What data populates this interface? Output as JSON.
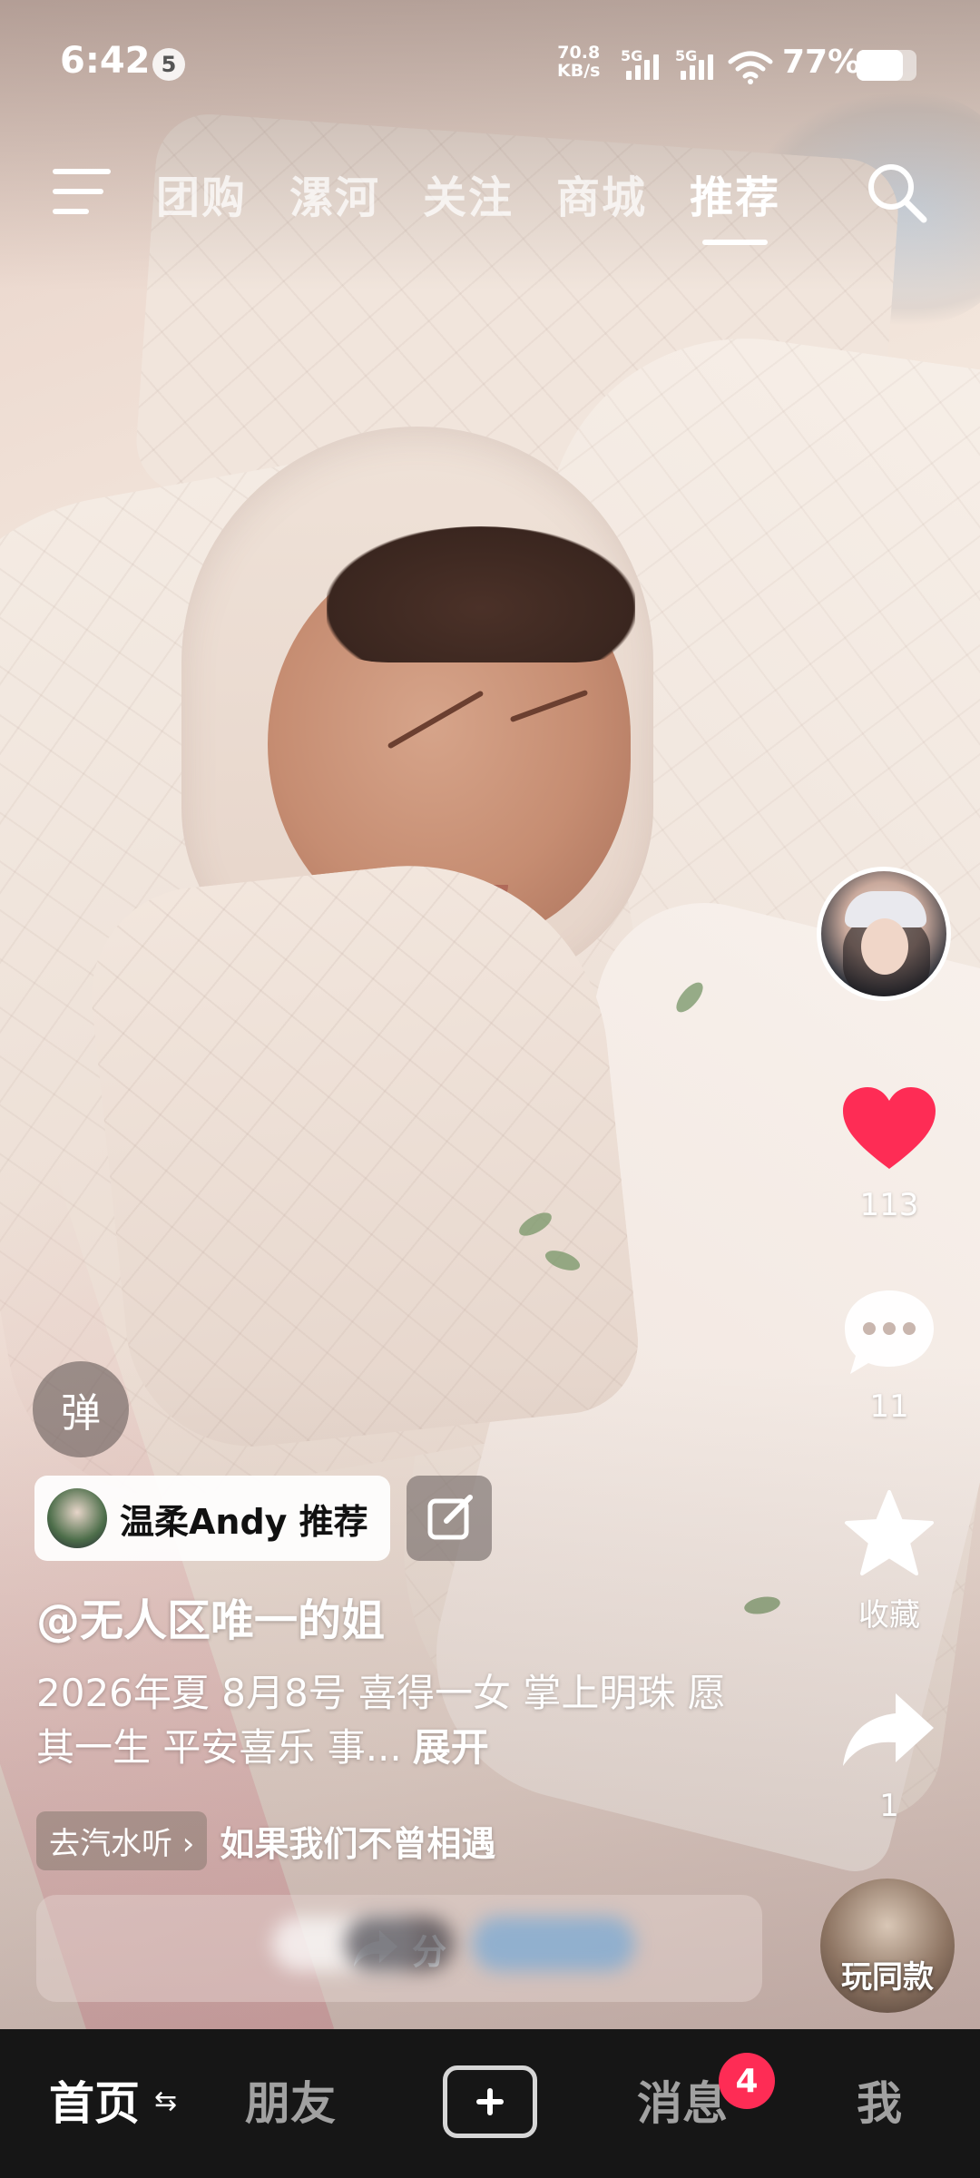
{
  "status_bar": {
    "time": "6:42",
    "notification_count": "5",
    "speed_value": "70.8",
    "speed_unit": "KB/s",
    "network_1": "5G",
    "network_2": "5G",
    "battery_percent": "77%",
    "battery_level": 0.77
  },
  "top_nav": {
    "tabs": [
      {
        "label": "团购",
        "active": false
      },
      {
        "label": "漯河",
        "active": false
      },
      {
        "label": "关注",
        "active": false
      },
      {
        "label": "商城",
        "active": false
      },
      {
        "label": "推荐",
        "active": true
      }
    ]
  },
  "right_rail": {
    "like_count": "113",
    "comment_count": "11",
    "favorite_label": "收藏",
    "share_count": "1",
    "use_same_label": "玩同款"
  },
  "overlay": {
    "danmu_label": "弹",
    "recommend_text": "温柔Andy 推荐",
    "author": "@无人区唯一的姐",
    "caption": "2026年夏 8月8号 喜得一女 掌上明珠 愿其一生 平安喜乐 事...",
    "caption_more": "展开",
    "music_chip": "去汽水听 ›",
    "music_title": "如果我们不曾相遇",
    "share_bar_label": "分"
  },
  "bottom_nav": {
    "home": "首页",
    "home_refresh_glyph": "⇆",
    "friends": "朋友",
    "messages": "消息",
    "messages_badge": "4",
    "me": "我"
  },
  "colors": {
    "like_red": "#fe2c55",
    "nav_bg": "#161616"
  }
}
